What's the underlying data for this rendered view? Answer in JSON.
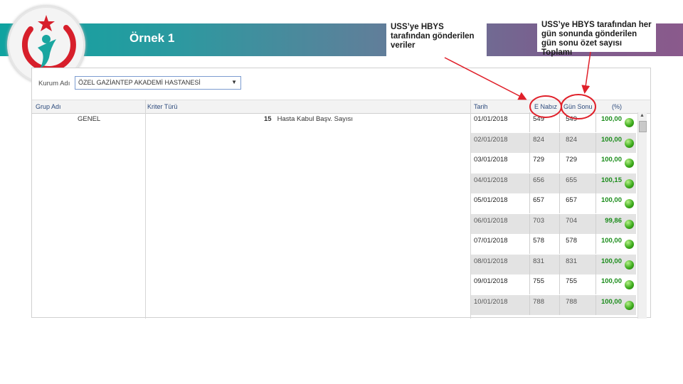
{
  "slide": {
    "title": "Örnek 1"
  },
  "callouts": [
    "USS’ye HBYS tarafından gönderilen veriler",
    "USS’ye HBYS tarafından her gün sonunda gönderilen gün sonu özet sayısı Toplamı"
  ],
  "filter": {
    "label": "Kurum Adı",
    "value": "ÖZEL GAZİANTEP AKADEMİ HASTANESİ"
  },
  "table": {
    "headers": {
      "group": "Grup Adı",
      "criteria": "Kriter Türü",
      "date": "Tarih",
      "enabiz": "E Nabız",
      "gunsonu": "Gün Sonu",
      "percent": "(%)"
    },
    "group_value": "GENEL",
    "criteria_code": "15",
    "criteria_name": "Hasta Kabul Başv. Sayısı",
    "rows": [
      {
        "date": "01/01/2018",
        "enabiz": "549",
        "gunsonu": "549",
        "percent": "100,00"
      },
      {
        "date": "02/01/2018",
        "enabiz": "824",
        "gunsonu": "824",
        "percent": "100,00"
      },
      {
        "date": "03/01/2018",
        "enabiz": "729",
        "gunsonu": "729",
        "percent": "100,00"
      },
      {
        "date": "04/01/2018",
        "enabiz": "656",
        "gunsonu": "655",
        "percent": "100,15"
      },
      {
        "date": "05/01/2018",
        "enabiz": "657",
        "gunsonu": "657",
        "percent": "100,00"
      },
      {
        "date": "06/01/2018",
        "enabiz": "703",
        "gunsonu": "704",
        "percent": "99,86"
      },
      {
        "date": "07/01/2018",
        "enabiz": "578",
        "gunsonu": "578",
        "percent": "100,00"
      },
      {
        "date": "08/01/2018",
        "enabiz": "831",
        "gunsonu": "831",
        "percent": "100,00"
      },
      {
        "date": "09/01/2018",
        "enabiz": "755",
        "gunsonu": "755",
        "percent": "100,00"
      },
      {
        "date": "10/01/2018",
        "enabiz": "788",
        "gunsonu": "788",
        "percent": "100,00"
      }
    ]
  },
  "colors": {
    "banner_start": "#0fa3a0",
    "banner_end": "#8a5a8c",
    "annotation": "#e0202a",
    "percent_text": "#1b8c1b",
    "status_ok": "#3fae1e"
  },
  "icons": {
    "logo": "ministry-logo",
    "status": "green-status-ball",
    "dropdown": "chevron-down-icon"
  }
}
